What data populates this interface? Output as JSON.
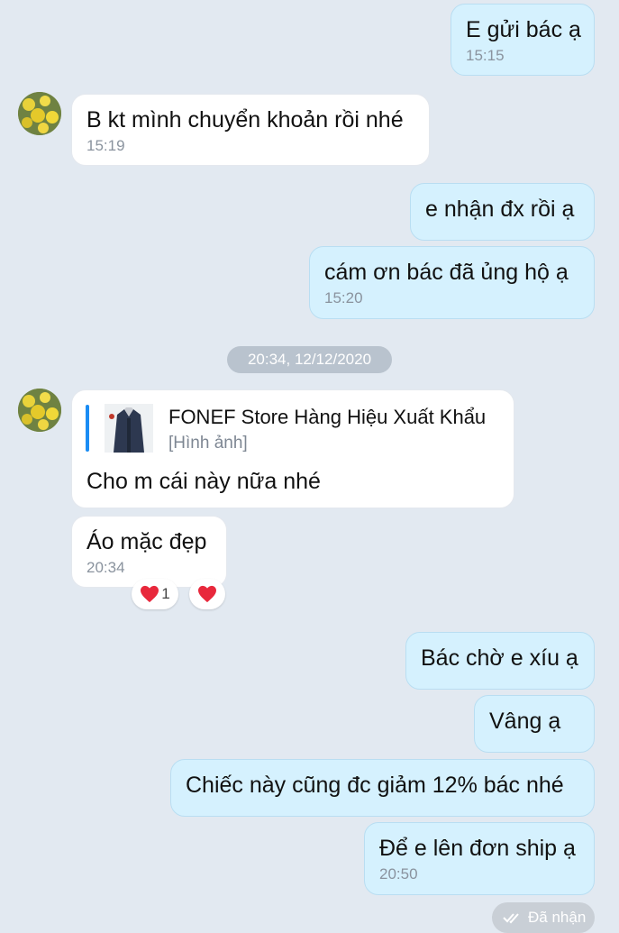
{
  "chat": {
    "messages": [
      {
        "text": "E gửi bác ạ",
        "time": "15:15"
      },
      {
        "text": "B kt mình chuyển khoản rồi nhé",
        "time": "15:19"
      },
      {
        "text": "e nhận đx rồi ạ"
      },
      {
        "text": "cám ơn bác đã ủng hộ ạ",
        "time": "15:20"
      },
      {
        "text": "Cho m cái này nữa nhé"
      },
      {
        "text": "Áo mặc đẹp",
        "time": "20:34"
      },
      {
        "text": "Bác chờ e xíu ạ"
      },
      {
        "text": "Vâng ạ"
      },
      {
        "text": "Chiếc này cũng đc giảm 12% bác nhé"
      },
      {
        "text": "Để e lên đơn ship ạ",
        "time": "20:50"
      }
    ],
    "divider": "20:34, 12/12/2020",
    "quote": {
      "title": "FONEF Store  Hàng Hiệu Xuất Khẩu",
      "subtitle": "[Hình ảnh]"
    },
    "reaction_count": "1",
    "received_status": "Đã nhận",
    "colors": {
      "outgoing_bubble": "#d5f1fe",
      "incoming_bubble": "#ffffff",
      "background": "#e2e9f1",
      "quote_bar": "#1a8cf4"
    }
  }
}
